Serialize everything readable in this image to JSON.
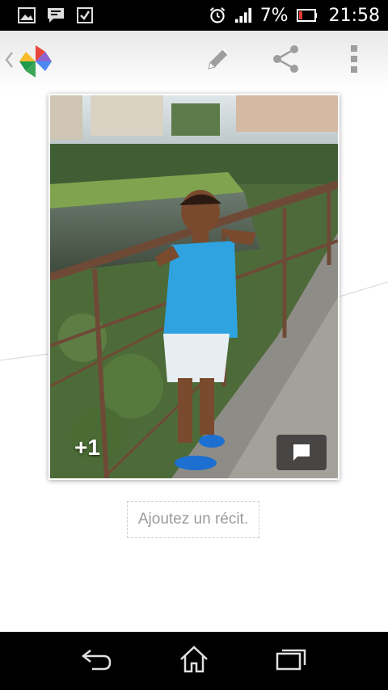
{
  "status_bar": {
    "battery_percent": "7%",
    "time": "21:58",
    "notification_icons": [
      "gallery-icon",
      "chat-notification-icon",
      "checkbox-icon"
    ],
    "system_icons": [
      "alarm-clock-icon",
      "signal-icon",
      "battery-low-icon"
    ]
  },
  "action_bar": {
    "app_icon": "photos-pinwheel-icon",
    "actions": [
      "edit-pencil-icon",
      "share-icon",
      "overflow-menu-icon"
    ]
  },
  "photo": {
    "plus_one_label": "+1",
    "comment_icon": "comment-icon"
  },
  "caption": {
    "placeholder": "Ajoutez un récit."
  },
  "nav_bar": {
    "buttons": [
      "back-icon",
      "home-icon",
      "recents-icon"
    ]
  },
  "colors": {
    "status_bar": "#000000",
    "nav_bar": "#000000",
    "logo_red": "#e8453c",
    "logo_yellow": "#f9bb2d",
    "logo_green": "#3aa757",
    "logo_blue": "#4a89f3",
    "caption_text": "#9a9a9a"
  }
}
